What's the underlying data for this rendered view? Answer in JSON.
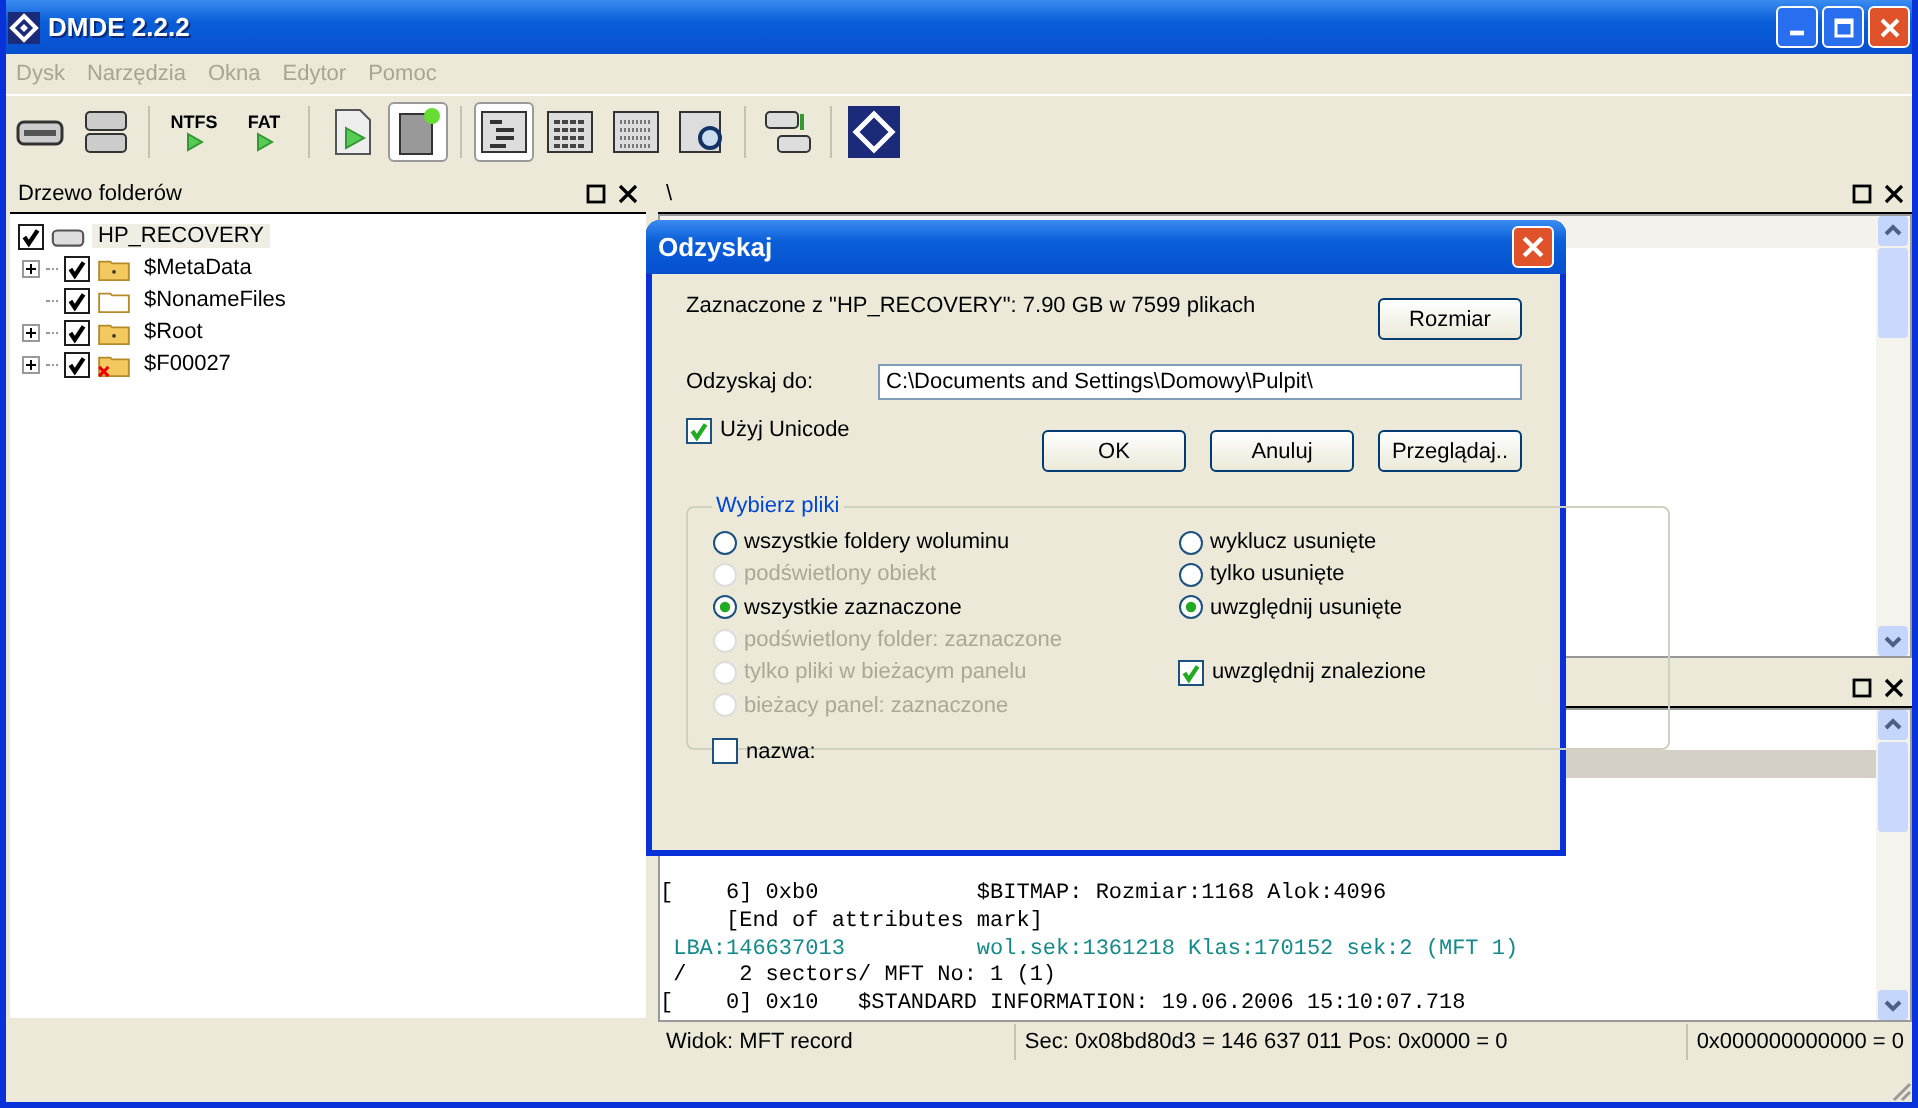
{
  "window": {
    "title": "DMDE 2.2.2"
  },
  "menu": [
    "Dysk",
    "Narzędzia",
    "Okna",
    "Edytor",
    "Pomoc"
  ],
  "toolbar": [
    {
      "kind": "drive",
      "pressed": false
    },
    {
      "kind": "drives",
      "pressed": false
    },
    {
      "kind": "sep"
    },
    {
      "kind": "text",
      "label": "NTFS",
      "pressed": false
    },
    {
      "kind": "text",
      "label": "FAT",
      "pressed": false
    },
    {
      "kind": "sep"
    },
    {
      "kind": "file",
      "pressed": false
    },
    {
      "kind": "newpage",
      "pressed": true
    },
    {
      "kind": "sep"
    },
    {
      "kind": "tree",
      "pressed": true
    },
    {
      "kind": "list",
      "pressed": false
    },
    {
      "kind": "grid",
      "pressed": false
    },
    {
      "kind": "search",
      "pressed": false
    },
    {
      "kind": "sep"
    },
    {
      "kind": "copy",
      "pressed": false
    },
    {
      "kind": "sep"
    },
    {
      "kind": "logo",
      "pressed": false
    }
  ],
  "tree_panel": {
    "title": "Drzewo folderów",
    "items": [
      {
        "label": "HP_RECOVERY",
        "kind": "drive",
        "checked": true,
        "selected": true,
        "children": [
          {
            "label": "$MetaData",
            "kind": "folder",
            "checked": true,
            "selected": false,
            "expandable": true
          },
          {
            "label": "$NonameFiles",
            "kind": "empty",
            "checked": true,
            "selected": false,
            "expandable": false
          },
          {
            "label": "$Root",
            "kind": "folder",
            "checked": true,
            "selected": false,
            "expandable": true
          },
          {
            "label": "$F00027",
            "kind": "lost",
            "checked": true,
            "selected": false,
            "expandable": true
          }
        ]
      }
    ]
  },
  "files_panel": {
    "title": "\\"
  },
  "record_panel": {
    "lines": [
      {
        "kind": "plain",
        "text": "[    6] 0xb0            $BITMAP: Rozmiar:1168 Alok:4096"
      },
      {
        "kind": "plain",
        "text": "     [End of attributes mark]"
      },
      {
        "kind": "info",
        "text": " LBA:146637013          wol.sek:1361218 Klas:170152 sek:2 (MFT 1)"
      },
      {
        "kind": "plain",
        "text": " /    2 sectors/ MFT No: 1 (1)"
      },
      {
        "kind": "plain",
        "text": "[    0] 0x10   $STANDARD INFORMATION: 19.06.2006 15:10:07.718"
      }
    ],
    "status": [
      "Widok: MFT record",
      "Sec: 0x08bd80d3 = 146 637 011  Pos: 0x0000 = 0",
      "0x000000000000 = 0"
    ]
  },
  "dialog": {
    "title": "Odzyskaj",
    "summary": "Zaznaczone z \"HP_RECOVERY\": 7.90 GB w 7599 plikach",
    "size_button": "Rozmiar",
    "target_label": "Odzyskaj do:",
    "target_value": "C:\\Documents and Settings\\Domowy\\Pulpit\\",
    "unicode": {
      "label": "Użyj Unicode",
      "checked": true
    },
    "buttons": [
      "OK",
      "Anuluj",
      "Przeglądaj.."
    ],
    "group": {
      "title": "Wybierz pliki",
      "scope": [
        {
          "label": "wszystkie foldery woluminu",
          "selected": false,
          "disabled": false
        },
        {
          "label": "podświetlony obiekt",
          "selected": false,
          "disabled": true
        },
        {
          "label": "wszystkie zaznaczone",
          "selected": true,
          "disabled": false
        },
        {
          "label": "podświetlony folder: zaznaczone",
          "selected": false,
          "disabled": true
        },
        {
          "label": "tylko pliki w bieżacym panelu",
          "selected": false,
          "disabled": true
        },
        {
          "label": "bieżacy panel: zaznaczone",
          "selected": false,
          "disabled": true
        }
      ],
      "deleted": [
        {
          "label": "wyklucz usunięte",
          "selected": false
        },
        {
          "label": "tylko usunięte",
          "selected": false
        },
        {
          "label": "uwzględnij usunięte",
          "selected": true
        }
      ],
      "found": {
        "label": "uwzględnij znalezione",
        "checked": true
      },
      "name": {
        "label": "nazwa:",
        "checked": false
      }
    }
  }
}
